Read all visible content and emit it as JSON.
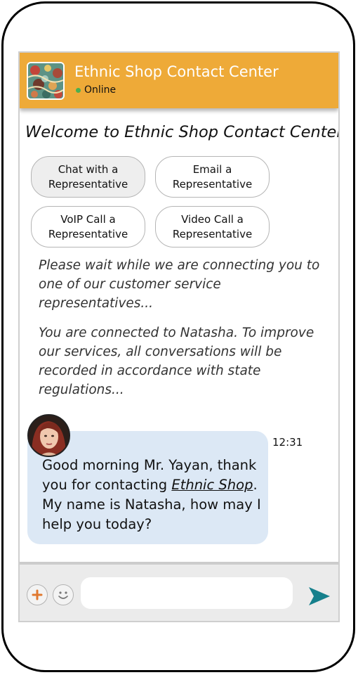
{
  "header": {
    "title": "Ethnic Shop Contact Center",
    "status": "Online",
    "status_color": "#4caf50",
    "background_color": "#eeaa38",
    "logo_icon": "mosaic-pattern-logo"
  },
  "welcome": "Welcome to Ethnic Shop Contact Center",
  "options": {
    "chat": {
      "line1": "Chat with a",
      "line2": "Representative"
    },
    "email": {
      "line1": "Email a",
      "line2": "Representative"
    },
    "voip": {
      "line1": "VoIP Call a",
      "line2": "Representative"
    },
    "video": {
      "line1": "Video Call a",
      "line2": "Representative"
    }
  },
  "system_messages": {
    "connecting": "Please wait while we are connecting you to one of our customer service representatives...",
    "connected": "You are connected to Natasha. To improve our services, all conversations will be recorded in accordance with state regulations..."
  },
  "chat": {
    "agent_avatar": "agent-portrait",
    "time": "12:31",
    "message_part1": "Good morning Mr. Yayan, thank you for contacting ",
    "message_link": "Ethnic Shop",
    "message_part2": ". My name is Natasha, how may I help you today?",
    "bubble_color": "#dce8f5"
  },
  "composer": {
    "placeholder": "",
    "add_icon": "plus-icon",
    "emoji_icon": "smiley-icon",
    "send_icon": "send-arrow-icon",
    "send_color": "#16808c"
  }
}
